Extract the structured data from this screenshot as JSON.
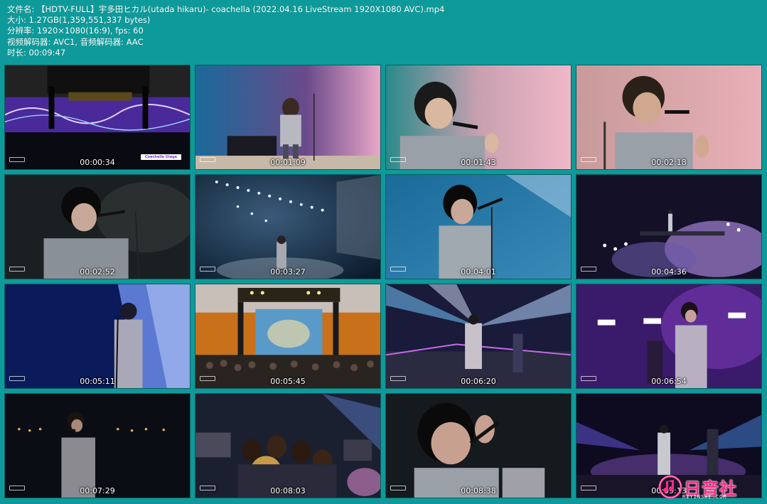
{
  "info": {
    "filename": "文件名: 【HDTV-FULL】宇多田ヒカル(utada hikaru)- coachella (2022.04.16 LiveStream 1920X1080 AVC).mp4",
    "size": "大小: 1.27GB(1,359,551,337 bytes)",
    "resolution": "分辨率: 1920×1080(16:9), fps: 60",
    "codecs": "视频解码器: AVC1, 音频解码器: AAC",
    "duration": "时长: 00:09:47"
  },
  "thumbnails": [
    {
      "time": "00:00:34",
      "scene": "stage-wide",
      "badge": "Coachella Stage"
    },
    {
      "time": "00:01:09",
      "scene": "singer-stage-pink"
    },
    {
      "time": "00:01:43",
      "scene": "closeup-pink"
    },
    {
      "time": "00:02:18",
      "scene": "closeup-pink-2"
    },
    {
      "time": "00:02:52",
      "scene": "closeup-dark"
    },
    {
      "time": "00:03:27",
      "scene": "singer-lights-blue"
    },
    {
      "time": "00:04:01",
      "scene": "singer-blue"
    },
    {
      "time": "00:04:36",
      "scene": "stage-purple-smoke"
    },
    {
      "time": "00:05:11",
      "scene": "singer-blue-light"
    },
    {
      "time": "00:05:45",
      "scene": "crowd-daylight"
    },
    {
      "time": "00:06:20",
      "scene": "stage-lasers"
    },
    {
      "time": "00:06:54",
      "scene": "singer-purple"
    },
    {
      "time": "00:07:29",
      "scene": "singer-night"
    },
    {
      "time": "00:08:03",
      "scene": "crowd-night"
    },
    {
      "time": "00:08:38",
      "scene": "closeup-singing"
    },
    {
      "time": "00:09:13",
      "scene": "stage-night-band"
    }
  ],
  "watermark": {
    "text": "日音社",
    "sub": "RIYINSHE.COM"
  },
  "colors": {
    "background": "#0e9a9a",
    "text": "#ffffff",
    "logo": "#ff2a8a"
  }
}
